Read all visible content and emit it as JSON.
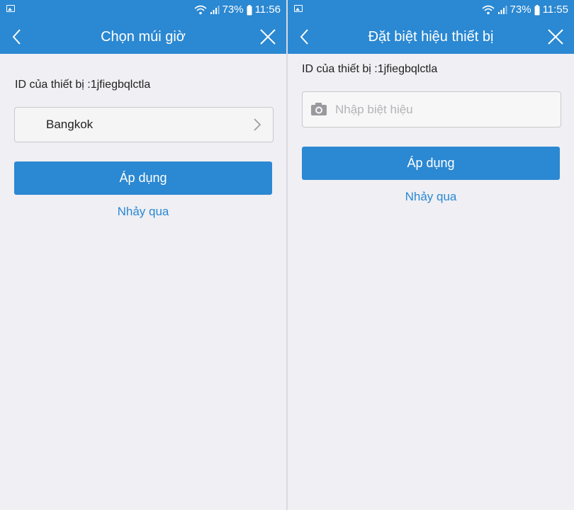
{
  "colors": {
    "accent": "#2b88d2",
    "background": "#efeff4"
  },
  "left_screen": {
    "status": {
      "battery_percent": "73%",
      "time": "11:56"
    },
    "title": "Chọn múi giờ",
    "device_id": "ID của thiết bị :1jfiegbqlctla",
    "timezone_value": "Bangkok",
    "apply_label": "Áp dụng",
    "skip_label": "Nhảy qua"
  },
  "right_screen": {
    "status": {
      "battery_percent": "73%",
      "time": "11:55"
    },
    "title": "Đặt biệt hiệu thiết bị",
    "device_id": "ID của thiết bị :1jfiegbqlctla",
    "nickname_placeholder": "Nhập biệt hiệu",
    "nickname_value": "",
    "apply_label": "Áp dụng",
    "skip_label": "Nhảy qua"
  },
  "icons": {
    "back": "chevron-left-icon",
    "close": "close-icon",
    "chevron": "chevron-right-icon",
    "camera": "camera-icon",
    "wifi": "wifi-icon",
    "signal": "signal-icon",
    "battery": "battery-icon",
    "gallery": "image-icon"
  }
}
